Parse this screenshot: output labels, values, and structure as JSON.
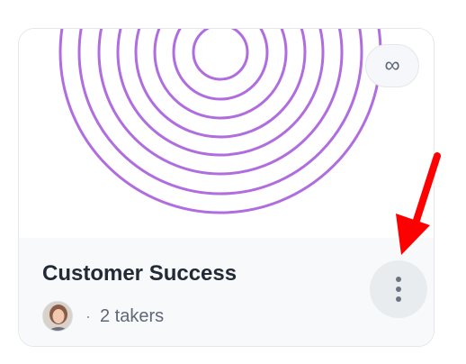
{
  "card": {
    "title": "Customer Success",
    "badge_icon": "infinity-icon",
    "badge_symbol": "∞",
    "meta": {
      "separator": "·",
      "takers_text": "2 takers"
    },
    "more_icon": "more-vertical-icon"
  },
  "colors": {
    "rings": "#b06de0",
    "annotation_arrow": "#ff0000",
    "title": "#222a35",
    "muted_text": "#5e6877",
    "footer_bg": "#f8f9fb"
  }
}
